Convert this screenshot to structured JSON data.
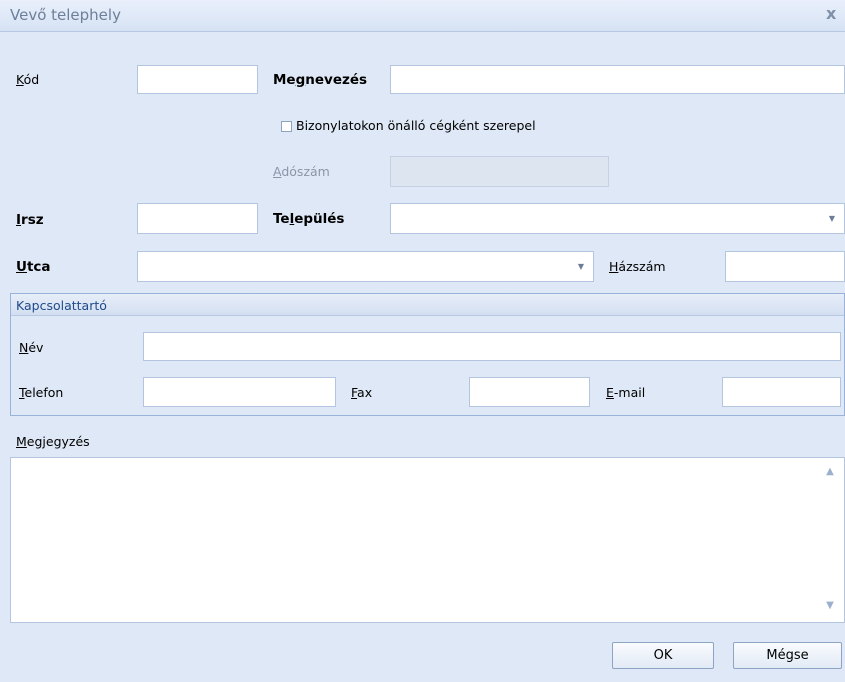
{
  "window": {
    "title": "Vevő telephely",
    "close_glyph": "x"
  },
  "form": {
    "kod": {
      "label_key": "K",
      "label_rest": "ód",
      "value": ""
    },
    "megnevezes": {
      "label_pre": "Me",
      "label_key": "g",
      "label_rest": "nevezés",
      "value": ""
    },
    "checkbox": {
      "label": "Bizonylatokon önálló cégként szerepel",
      "checked": false
    },
    "adoszam": {
      "label_key": "A",
      "label_rest": "dószám",
      "value": "",
      "disabled": true
    },
    "irsz": {
      "label_key": "I",
      "label_rest": "rsz",
      "value": ""
    },
    "telepules": {
      "label_pre": "Te",
      "label_key": "l",
      "label_rest": "epülés",
      "value": ""
    },
    "utca": {
      "label_key": "U",
      "label_rest": "tca",
      "value": ""
    },
    "hazszam": {
      "label_key": "H",
      "label_rest": "ázszám",
      "value": ""
    }
  },
  "contact": {
    "title": "Kapcsolattartó",
    "nev": {
      "label_key": "N",
      "label_rest": "év",
      "value": ""
    },
    "telefon": {
      "label_key": "T",
      "label_rest": "elefon",
      "value": ""
    },
    "fax": {
      "label_key": "F",
      "label_rest": "ax",
      "value": ""
    },
    "email": {
      "label_key": "E",
      "label_rest": "-mail",
      "value": ""
    }
  },
  "notes": {
    "label_key": "M",
    "label_rest": "egjegyzés",
    "value": ""
  },
  "buttons": {
    "ok": "OK",
    "cancel": "Mégse"
  },
  "colors": {
    "background": "#dfe8f6",
    "border": "#b3c5df",
    "accent_text": "#1f4a8a"
  }
}
